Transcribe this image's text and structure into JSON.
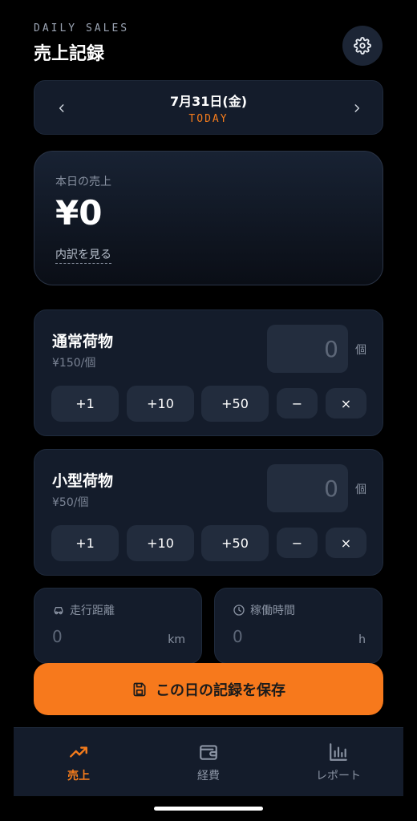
{
  "header": {
    "eyebrow": "DAILY SALES",
    "title": "売上記録"
  },
  "date_nav": {
    "date": "7月31日(金)",
    "today": "TODAY"
  },
  "total": {
    "label": "本日の売上",
    "amount": "¥0",
    "breakdown_link": "内訳を見る"
  },
  "items": [
    {
      "name": "通常荷物",
      "price": "¥150/個",
      "quantity": "0",
      "unit": "個",
      "buttons": [
        "+1",
        "+10",
        "+50",
        "−",
        "×"
      ]
    },
    {
      "name": "小型荷物",
      "price": "¥50/個",
      "quantity": "0",
      "unit": "個",
      "buttons": [
        "+1",
        "+10",
        "+50",
        "−",
        "×"
      ]
    }
  ],
  "metrics": [
    {
      "label": "走行距離",
      "value": "0",
      "unit": "km",
      "icon": "car-icon"
    },
    {
      "label": "稼働時間",
      "value": "0",
      "unit": "h",
      "icon": "clock-icon"
    }
  ],
  "save_button": {
    "label": "この日の記録を保存"
  },
  "tabs": [
    {
      "label": "売上",
      "icon": "trending-up-icon",
      "active": true
    },
    {
      "label": "経費",
      "icon": "wallet-icon",
      "active": false
    },
    {
      "label": "レポート",
      "icon": "bar-chart-icon",
      "active": false
    }
  ],
  "colors": {
    "accent": "#f7791c",
    "card": "#141c2b",
    "button": "#222c3d",
    "background": "#000000"
  }
}
